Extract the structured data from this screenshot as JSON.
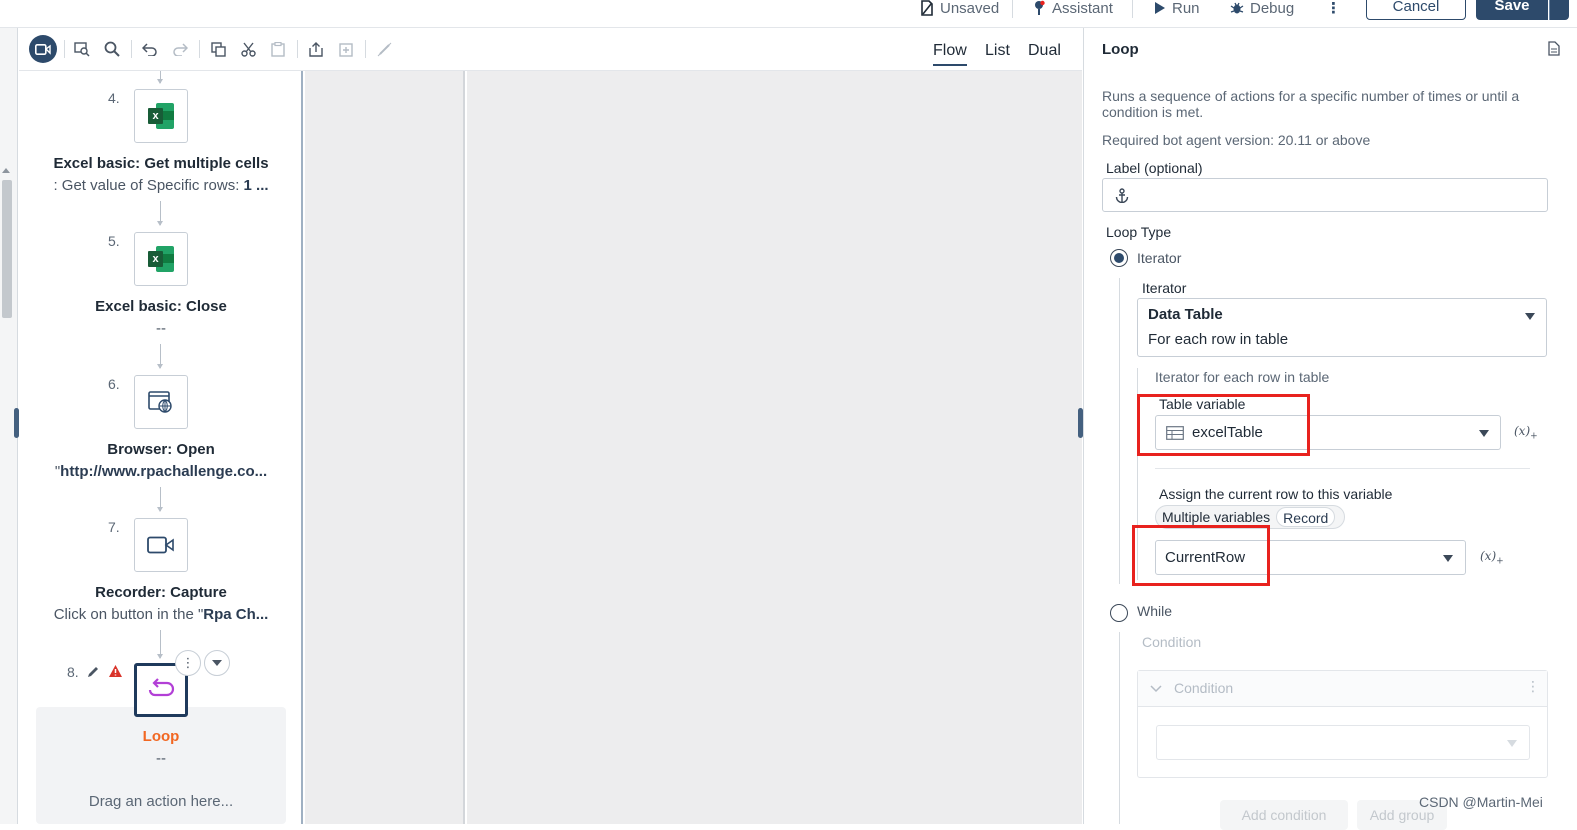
{
  "topbar": {
    "unsaved": "Unsaved",
    "assistant": "Assistant",
    "run": "Run",
    "debug": "Debug",
    "cancel": "Cancel",
    "save": "Save"
  },
  "view_tabs": {
    "flow": "Flow",
    "list": "List",
    "dual": "Dual",
    "active": "Flow"
  },
  "flow": {
    "steps": [
      {
        "num": "4.",
        "title": "Excel basic: Get multiple cells",
        "sub_prefix": ": Get value of Specific rows: ",
        "sub_bold": "1 ...",
        "icon": "excel-icon"
      },
      {
        "num": "5.",
        "title": "Excel basic: Close",
        "sub": "--",
        "icon": "excel-icon"
      },
      {
        "num": "6.",
        "title": "Browser: Open",
        "sub_prefix": "\"",
        "sub_bold": "http://www.rpachallenge.co...",
        "icon": "browser-globe-icon"
      },
      {
        "num": "7.",
        "title": "Recorder: Capture",
        "sub_prefix": "Click on button in the \"",
        "sub_bold": "Rpa Ch...",
        "icon": "video-camera-icon"
      }
    ],
    "loop": {
      "num": "8.",
      "title": "Loop",
      "sub": "--",
      "drop_hint": "Drag an action here..."
    }
  },
  "props": {
    "title": "Loop",
    "description": "Runs a sequence of actions for a specific number of times or until a condition is met.",
    "version": "Required bot agent version: 20.11 or above",
    "label_field": "Label (optional)",
    "loop_type": "Loop Type",
    "iterator_option": "Iterator",
    "iterator_label": "Iterator",
    "iterator_value": "Data Table",
    "iterator_desc": "For each row in table",
    "iterator_hint": "Iterator for each row in table",
    "table_variable_label": "Table variable",
    "table_variable_value": "excelTable",
    "assign_label": "Assign the current row to this variable",
    "seg_multiple": "Multiple variables",
    "seg_record": "Record",
    "current_row_value": "CurrentRow",
    "while_option": "While",
    "condition_label": "Condition",
    "condition_header": "Condition",
    "add_condition": "Add condition",
    "add_group": "Add group",
    "fx": "(x)"
  },
  "watermark": "CSDN @Martin-Mei",
  "colors": {
    "accent": "#2d4a6b",
    "highlight_red": "#e8221e",
    "loop_orange": "#f26722",
    "loop_icon": "#b23fd6"
  }
}
